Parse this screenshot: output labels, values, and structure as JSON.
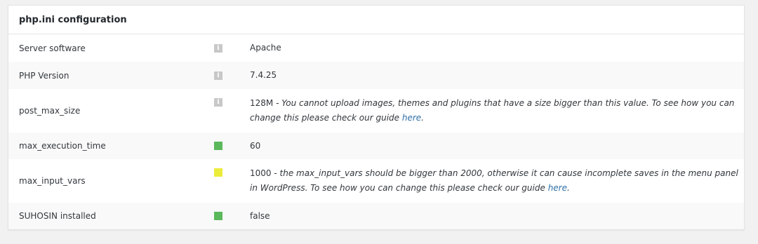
{
  "panel": {
    "title": "php.ini configuration"
  },
  "rows": [
    {
      "label": "Server software",
      "indicator": "info-icon",
      "value": "Apache"
    },
    {
      "label": "PHP Version",
      "indicator": "info-icon",
      "value": "7.4.25"
    },
    {
      "label": "post_max_size",
      "indicator": "info-icon",
      "value": "128M",
      "note": " - You cannot upload images, themes and plugins that have a size bigger than this value. To see how you can change this please check our guide ",
      "link_text": "here",
      "note_end": "."
    },
    {
      "label": "max_execution_time",
      "indicator": "status-green",
      "value": "60"
    },
    {
      "label": "max_input_vars",
      "indicator": "status-yellow",
      "value": "1000",
      "note": " - the max_input_vars should be bigger than 2000, otherwise it can cause incomplete saves in the menu panel in WordPress. To see how you can change this please check our guide ",
      "link_text": "here",
      "note_end": "."
    },
    {
      "label": "SUHOSIN installed",
      "indicator": "status-green",
      "value": "false"
    }
  ],
  "info_icon_glyph": "i",
  "colors": {
    "status_ok": "#5cb85c",
    "status_warning": "#ecec3a",
    "info": "#c8c8c8",
    "link": "#2f6fa8"
  }
}
